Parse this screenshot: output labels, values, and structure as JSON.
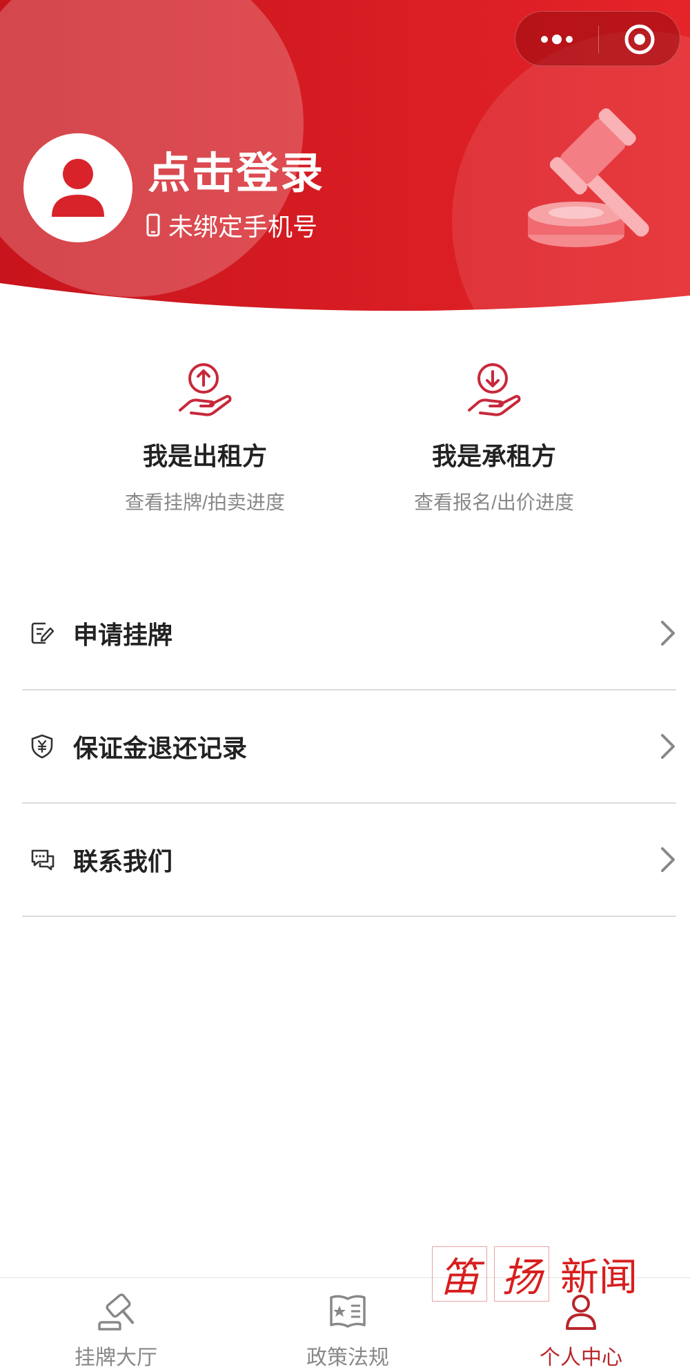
{
  "colors": {
    "brand_red": "#d9232b",
    "header_gradient": [
      "#c8141c",
      "#e52429"
    ],
    "text_primary": "#222222",
    "text_secondary": "#888888",
    "divider": "#dcdcdc"
  },
  "header": {
    "login_title": "点击登录",
    "phone_status": "未绑定手机号",
    "icons": {
      "avatar": "user-avatar-icon",
      "phone": "mobile-phone-icon",
      "decoration": "auction-gavel-icon",
      "capsule_more": "more-dots-icon",
      "capsule_close": "target-circle-icon"
    }
  },
  "roles": [
    {
      "title": "我是出租方",
      "subtitle": "查看挂牌/拍卖进度",
      "icon": "hand-coin-up-icon"
    },
    {
      "title": "我是承租方",
      "subtitle": "查看报名/出价进度",
      "icon": "hand-coin-down-icon"
    }
  ],
  "menu": [
    {
      "label": "申请挂牌",
      "icon": "edit-document-icon"
    },
    {
      "label": "保证金退还记录",
      "icon": "shield-yuan-icon"
    },
    {
      "label": "联系我们",
      "icon": "chat-bubbles-icon"
    }
  ],
  "watermark": {
    "char1": "笛",
    "char2": "扬",
    "text": "新闻"
  },
  "tabbar": {
    "active": 2,
    "items": [
      {
        "label": "挂牌大厅",
        "icon": "gavel-icon"
      },
      {
        "label": "政策法规",
        "icon": "policy-book-icon"
      },
      {
        "label": "个人中心",
        "icon": "person-icon"
      }
    ]
  }
}
